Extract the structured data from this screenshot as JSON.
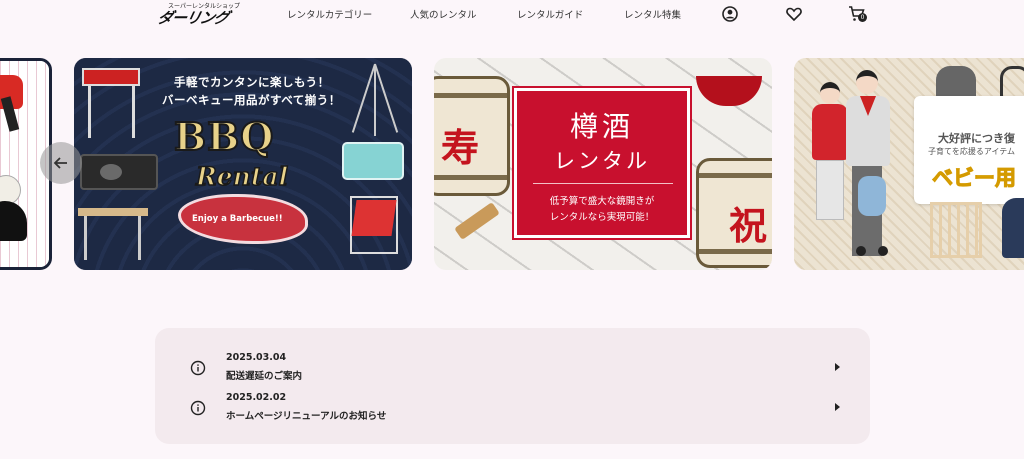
{
  "header": {
    "logo_small": "スーパーレンタルショップ",
    "logo_main": "ダーリング",
    "nav": [
      {
        "label": "レンタルカテゴリー"
      },
      {
        "label": "人気のレンタル"
      },
      {
        "label": "レンタルガイド"
      },
      {
        "label": "レンタル特集"
      }
    ],
    "cart_count": "0",
    "icons": [
      "account-icon",
      "heart-icon",
      "cart-icon"
    ]
  },
  "carousel": {
    "slides": [
      {
        "name": "sports-rental-banner"
      },
      {
        "name": "bbq-rental-banner",
        "headline1": "手軽でカンタンに楽しもう！",
        "headline2": "バーベキュー用品がすべて揃う！",
        "title": "BBQ",
        "subtitle": "Rental",
        "tagline": "Enjoy a Barbecue!!"
      },
      {
        "name": "taruzake-rental-banner",
        "title": "樽酒",
        "subtitle": "レンタル",
        "desc1": "低予算で盛大な鏡開きが",
        "desc2": "レンタルなら実現可能！",
        "kanji_left": "寿",
        "kanji_right": "祝"
      },
      {
        "name": "baby-rental-banner",
        "line1": "大好評につき復",
        "line2": "子育てを応援るアイテム",
        "line3": "ベビー用"
      }
    ],
    "arrow_icons": [
      "arrow-left-icon",
      "arrow-right-icon"
    ]
  },
  "news": {
    "items": [
      {
        "date": "2025.03.04",
        "title": "配送遅延のご案内"
      },
      {
        "date": "2025.02.02",
        "title": "ホームページリニューアルのお知らせ"
      }
    ]
  },
  "colors": {
    "page_bg": "#fcf6fa",
    "news_bg": "#f3eaee",
    "bbq_bg": "#1d2944",
    "taru_red": "#c8102e",
    "baby_yellow": "#f5c400"
  }
}
